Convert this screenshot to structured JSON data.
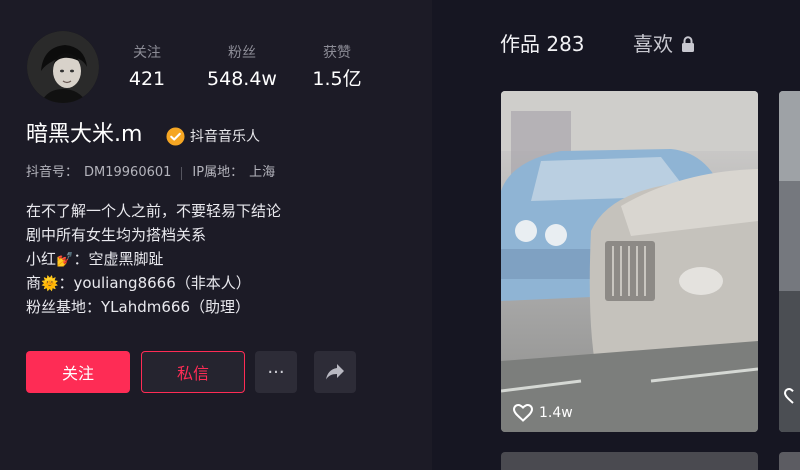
{
  "profile": {
    "username": "暗黑大米.m",
    "verify_label": "抖音音乐人",
    "id_label": "抖音号：",
    "id_value": "DM19960601",
    "ip_label": "IP属地：",
    "ip_value": "上海",
    "stats": [
      {
        "label": "关注",
        "value": "421"
      },
      {
        "label": "粉丝",
        "value": "548.4w"
      },
      {
        "label": "获赞",
        "value": "1.5亿"
      }
    ],
    "bio": {
      "line1": "在不了解一个人之前，不要轻易下结论",
      "line2": "剧中所有女生均为搭档关系",
      "line3_prefix": "小红",
      "line3_emoji": "💅",
      "line3_suffix": "：空虚黑脚趾",
      "line4_prefix": "商",
      "line4_emoji": "🌞",
      "line4_suffix": "：youliang8666（非本人）",
      "line5": "粉丝基地：YLahdm666（助理）"
    }
  },
  "actions": {
    "follow": "关注",
    "message": "私信",
    "more": "···"
  },
  "tabs": {
    "works": "作品 283",
    "likes": "喜欢"
  },
  "videos": [
    {
      "likes": "1.4w"
    }
  ],
  "colors": {
    "accent": "#fe2c55",
    "verify_badge": "#f5a623",
    "background": "#161622"
  }
}
